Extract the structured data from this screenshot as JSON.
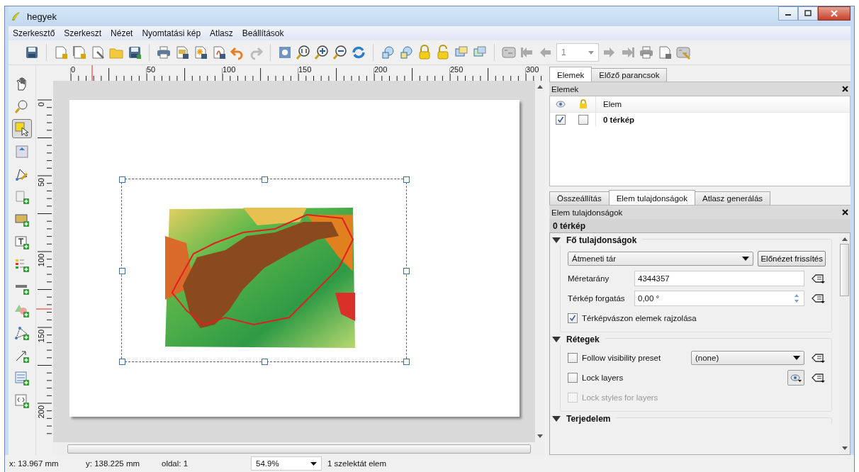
{
  "window": {
    "title": "hegyek"
  },
  "menu": [
    "Szerkesztő",
    "Szerkeszt",
    "Nézet",
    "Nyomtatási kép",
    "Atlasz",
    "Beállítások"
  ],
  "atlas_toolbar": {
    "page": "1"
  },
  "tools": [
    {
      "selected": false
    },
    {
      "selected": false
    },
    {
      "selected": true
    },
    {
      "selected": false
    },
    {
      "selected": false
    },
    {
      "selected": false
    },
    {
      "selected": false
    },
    {
      "selected": false
    },
    {
      "selected": false
    },
    {
      "selected": false
    },
    {
      "selected": false
    },
    {
      "selected": false
    },
    {
      "selected": false
    },
    {
      "selected": false
    },
    {
      "selected": false
    }
  ],
  "rulers": {
    "horizontal": [
      "0",
      "50",
      "100",
      "150",
      "200",
      "250",
      "300"
    ],
    "vertical": [
      "0",
      "50",
      "100",
      "150",
      "200"
    ]
  },
  "dock_tabs_top": [
    {
      "label": "Elemek",
      "selected": true
    },
    {
      "label": "Előző parancsok",
      "selected": false
    }
  ],
  "items_panel": {
    "title": "Elemek",
    "column": "Elem",
    "rows": [
      {
        "name": "0 térkép",
        "visible": true,
        "locked": false
      }
    ]
  },
  "dock_tabs_bottom": [
    {
      "label": "Összeállítás",
      "selected": false
    },
    {
      "label": "Elem tulajdonságok",
      "selected": true
    },
    {
      "label": "Atlasz generálás",
      "selected": false
    }
  ],
  "properties_panel": {
    "title": "Elem tulajdonságok",
    "item_name": "0 térkép",
    "sections": [
      {
        "title": "Fő tulajdonságok",
        "expanded": true,
        "rows": [
          {
            "kind": "combo_button",
            "value": "Átmeneti tár",
            "button": "Előnézet frissítés"
          },
          {
            "kind": "field",
            "label": "Méretarány",
            "value": "4344357"
          },
          {
            "kind": "spin",
            "label": "Térkép forgatás",
            "value": "0,00 °"
          },
          {
            "kind": "checkbox",
            "label": "Térképvászon elemek rajzolása",
            "checked": true,
            "disabled": false
          }
        ]
      },
      {
        "title": "Rétegek",
        "expanded": true,
        "rows": [
          {
            "kind": "checkbox_combo",
            "label": "Follow visibility preset",
            "checked": false,
            "value": "(none)"
          },
          {
            "kind": "checkbox_eye",
            "label": "Lock layers",
            "checked": false,
            "disabled": false
          },
          {
            "kind": "checkbox",
            "label": "Lock styles for layers",
            "checked": false,
            "disabled": true
          }
        ]
      },
      {
        "title": "Terjedelem",
        "expanded": true
      }
    ]
  },
  "status_bar": {
    "x": "x: 13.967 mm",
    "y": "y: 138.225 mm",
    "page": "oldal: 1",
    "zoom": "54.9%",
    "selection": "1 szelektát elem"
  }
}
